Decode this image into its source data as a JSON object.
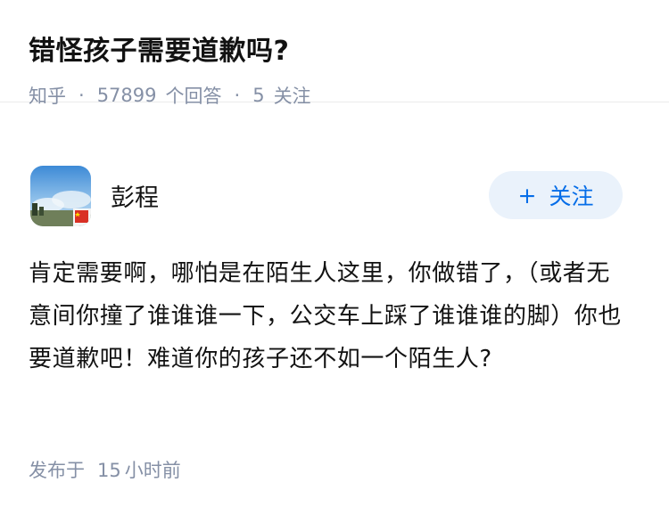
{
  "question": {
    "title": "错怪孩子需要道歉吗?",
    "source": "知乎",
    "answer_count": "57899",
    "answer_label": "个回答",
    "follow_count": "5",
    "follow_label": "关注"
  },
  "author": {
    "name": "彭程",
    "avatar_icon": "avatar-landscape-with-flag",
    "follow_button_icon": "plus-icon",
    "follow_button_label": "关注"
  },
  "answer": {
    "content": "肯定需要啊，哪怕是在陌生人这里，你做错了，（或者无意间你撞了谁谁谁一下，公交车上踩了谁谁谁的脚）你也要道歉吧！难道你的孩子还不如一个陌生人?"
  },
  "footer": {
    "published_label": "发布于",
    "published_value": "15",
    "published_unit": "小时前"
  },
  "colors": {
    "accent": "#056de8",
    "button_bg": "#eaf2fb",
    "meta_text": "#8590a6",
    "title_text": "#121212"
  }
}
